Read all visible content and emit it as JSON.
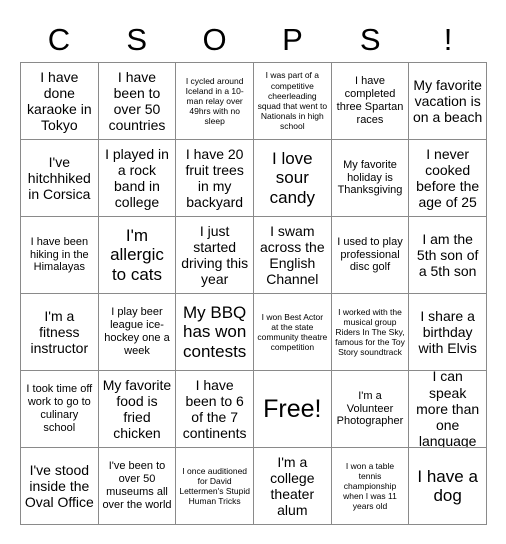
{
  "header": {
    "letters": [
      "C",
      "S",
      "O",
      "P",
      "S",
      "!"
    ]
  },
  "grid": {
    "columns": 6,
    "rows": 6,
    "cells": [
      {
        "text": "I have done karaoke in Tokyo",
        "size": "md",
        "free": false
      },
      {
        "text": "I have been to over 50 countries",
        "size": "md",
        "free": false
      },
      {
        "text": "I cycled around Iceland in a 10-man relay over 49hrs with no sleep",
        "size": "xs",
        "free": false
      },
      {
        "text": "I was part of a competitive cheerleading squad that went to Nationals in high school",
        "size": "xs",
        "free": false
      },
      {
        "text": "I have completed three Spartan races",
        "size": "sm",
        "free": false
      },
      {
        "text": "My favorite vacation is on a beach",
        "size": "md",
        "free": false
      },
      {
        "text": "I've hitchhiked in Corsica",
        "size": "md",
        "free": false
      },
      {
        "text": "I played in a rock band in college",
        "size": "md",
        "free": false
      },
      {
        "text": "I have 20 fruit trees in my backyard",
        "size": "md",
        "free": false
      },
      {
        "text": "I love sour candy",
        "size": "lg",
        "free": false
      },
      {
        "text": "My favorite holiday is Thanksgiving",
        "size": "sm",
        "free": false
      },
      {
        "text": "I never cooked before the age of 25",
        "size": "md",
        "free": false
      },
      {
        "text": "I have been hiking in the Himalayas",
        "size": "sm",
        "free": false
      },
      {
        "text": "I'm allergic to cats",
        "size": "lg",
        "free": false
      },
      {
        "text": "I just started driving this year",
        "size": "md",
        "free": false
      },
      {
        "text": "I swam across the English Channel",
        "size": "md",
        "free": false
      },
      {
        "text": "I used to play professional disc golf",
        "size": "sm",
        "free": false
      },
      {
        "text": "I am the 5th son of a 5th son",
        "size": "md",
        "free": false
      },
      {
        "text": "I'm a fitness instructor",
        "size": "md",
        "free": false
      },
      {
        "text": "I play beer league ice-hockey one a week",
        "size": "sm",
        "free": false
      },
      {
        "text": "My BBQ has won contests",
        "size": "lg",
        "free": false
      },
      {
        "text": "I won Best Actor at the state community theatre competition",
        "size": "xs",
        "free": false
      },
      {
        "text": "I worked with the musical group Riders In The Sky, famous for the Toy Story soundtrack",
        "size": "xs",
        "free": false
      },
      {
        "text": "I share a birthday with Elvis",
        "size": "md",
        "free": false
      },
      {
        "text": "I took time off work to go to culinary school",
        "size": "sm",
        "free": false
      },
      {
        "text": "My favorite food is fried chicken",
        "size": "md",
        "free": false
      },
      {
        "text": "I have been to 6 of the 7 continents",
        "size": "md",
        "free": false
      },
      {
        "text": "Free!",
        "size": "xl",
        "free": true
      },
      {
        "text": "I'm a Volunteer Photographer",
        "size": "sm",
        "free": false
      },
      {
        "text": "I can speak more than one language",
        "size": "md",
        "free": false
      },
      {
        "text": "I've stood inside the Oval Office",
        "size": "md",
        "free": false
      },
      {
        "text": "I've been to over 50 museums all over the world",
        "size": "sm",
        "free": false
      },
      {
        "text": "I once auditioned for David Lettermen's Stupid Human Tricks",
        "size": "xs",
        "free": false
      },
      {
        "text": "I'm a college theater alum",
        "size": "md",
        "free": false
      },
      {
        "text": "I won a table tennis championship when I was 11 years old",
        "size": "xs",
        "free": false
      },
      {
        "text": "I have a dog",
        "size": "lg",
        "free": false
      }
    ]
  },
  "colors": {
    "background": "#ffffff",
    "grid_line": "#8a8a8a",
    "text": "#000000"
  }
}
